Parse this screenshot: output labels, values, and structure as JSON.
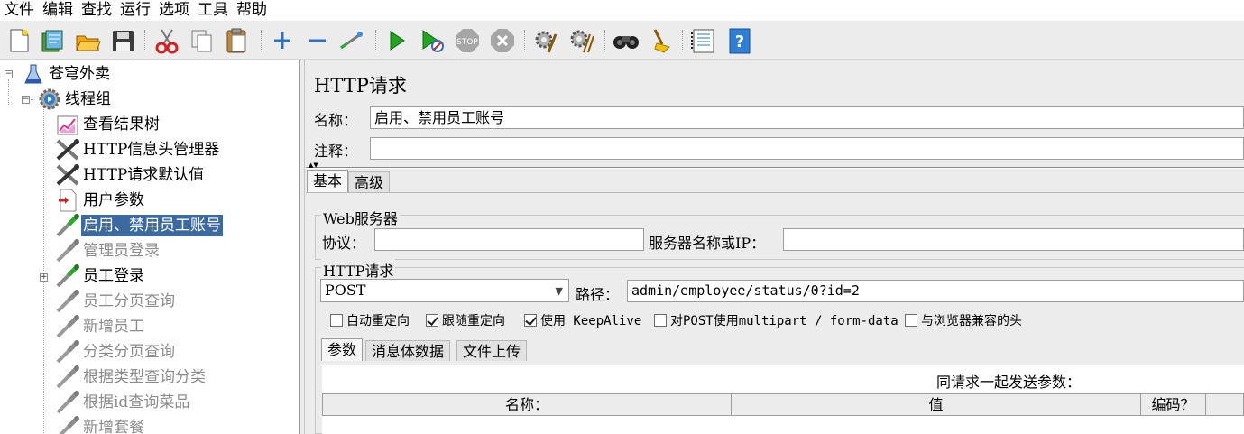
{
  "menu": [
    "文件",
    "编辑",
    "查找",
    "运行",
    "选项",
    "工具",
    "帮助"
  ],
  "toolbar": {
    "icons": [
      "new-icon",
      "templates-icon",
      "open-icon",
      "save-icon",
      "cut-icon",
      "copy-icon",
      "paste-icon",
      "expand-icon",
      "collapse-icon",
      "toggle-icon",
      "start-icon",
      "start-no-pause-icon",
      "stop-icon",
      "shutdown-icon",
      "clear-icon",
      "clear-all-icon",
      "search-icon",
      "reset-search-icon",
      "function-helper-icon",
      "help-icon"
    ]
  },
  "tree": {
    "items": [
      {
        "label": "苍穹外卖",
        "icon": "test-plan-icon",
        "state": "normal"
      },
      {
        "label": "线程组",
        "icon": "thread-group-icon",
        "state": "normal"
      },
      {
        "label": "查看结果树",
        "icon": "listener-chart-icon",
        "state": "normal"
      },
      {
        "label": "HTTP信息头管理器",
        "icon": "config-tools-icon",
        "state": "normal"
      },
      {
        "label": "HTTP请求默认值",
        "icon": "config-tools-icon",
        "state": "normal"
      },
      {
        "label": "用户参数",
        "icon": "preprocessor-icon",
        "state": "normal"
      },
      {
        "label": "启用、禁用员工账号",
        "icon": "sampler-pipette-icon",
        "state": "selected"
      },
      {
        "label": "管理员登录",
        "icon": "sampler-pipette-icon",
        "state": "disabled"
      },
      {
        "label": "员工登录",
        "icon": "sampler-pipette-icon",
        "state": "normal"
      },
      {
        "label": "员工分页查询",
        "icon": "sampler-pipette-icon",
        "state": "disabled"
      },
      {
        "label": "新增员工",
        "icon": "sampler-pipette-icon",
        "state": "disabled"
      },
      {
        "label": "分类分页查询",
        "icon": "sampler-pipette-icon",
        "state": "disabled"
      },
      {
        "label": "根据类型查询分类",
        "icon": "sampler-pipette-icon",
        "state": "disabled"
      },
      {
        "label": "根据id查询菜品",
        "icon": "sampler-pipette-icon",
        "state": "disabled"
      },
      {
        "label": "新增套餐",
        "icon": "sampler-pipette-icon",
        "state": "disabled"
      }
    ]
  },
  "panel": {
    "title": "HTTP请求",
    "name_label": "名称：",
    "name_value": "启用、禁用员工账号",
    "comment_label": "注释：",
    "comment_value": "",
    "tabs": [
      "基本",
      "高级"
    ],
    "web_server": {
      "title": "Web服务器",
      "protocol_label": "协议：",
      "protocol_value": "",
      "server_label": "服务器名称或IP：",
      "server_value": ""
    },
    "http_request": {
      "title": "HTTP请求",
      "method": "POST",
      "path_label": "路径：",
      "path_value": "admin/employee/status/0?id=2"
    },
    "checkboxes": [
      {
        "label": "自动重定向",
        "checked": false
      },
      {
        "label": "跟随重定向",
        "checked": true
      },
      {
        "label": "使用 KeepAlive",
        "checked": true
      },
      {
        "label": "对POST使用multipart / form-data",
        "checked": false
      },
      {
        "label": "与浏览器兼容的头",
        "checked": false
      }
    ],
    "subtabs": [
      "参数",
      "消息体数据",
      "文件上传"
    ],
    "params_caption": "同请求一起发送参数：",
    "columns": [
      "名称：",
      "值",
      "编码？"
    ]
  }
}
